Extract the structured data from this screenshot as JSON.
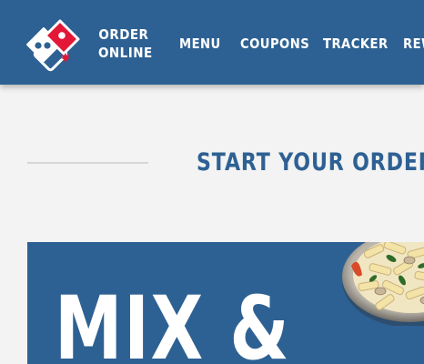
{
  "header": {
    "logo_icon": "dominos-domino-logo-icon",
    "order_online": [
      "ORDER",
      "ONLINE"
    ],
    "nav": [
      {
        "label": "MENU"
      },
      {
        "label": "COUPONS"
      },
      {
        "label": "TRACKER"
      },
      {
        "label": "REW"
      }
    ]
  },
  "main": {
    "start_order_heading": "START YOUR ORDER"
  },
  "promo": {
    "title": "MIX &",
    "image_icon": "pasta-dish-image"
  },
  "colors": {
    "brand_blue": "#2e6193",
    "brand_red": "#e31837",
    "background": "#f3f3f3",
    "divider": "#d6d6d6"
  }
}
